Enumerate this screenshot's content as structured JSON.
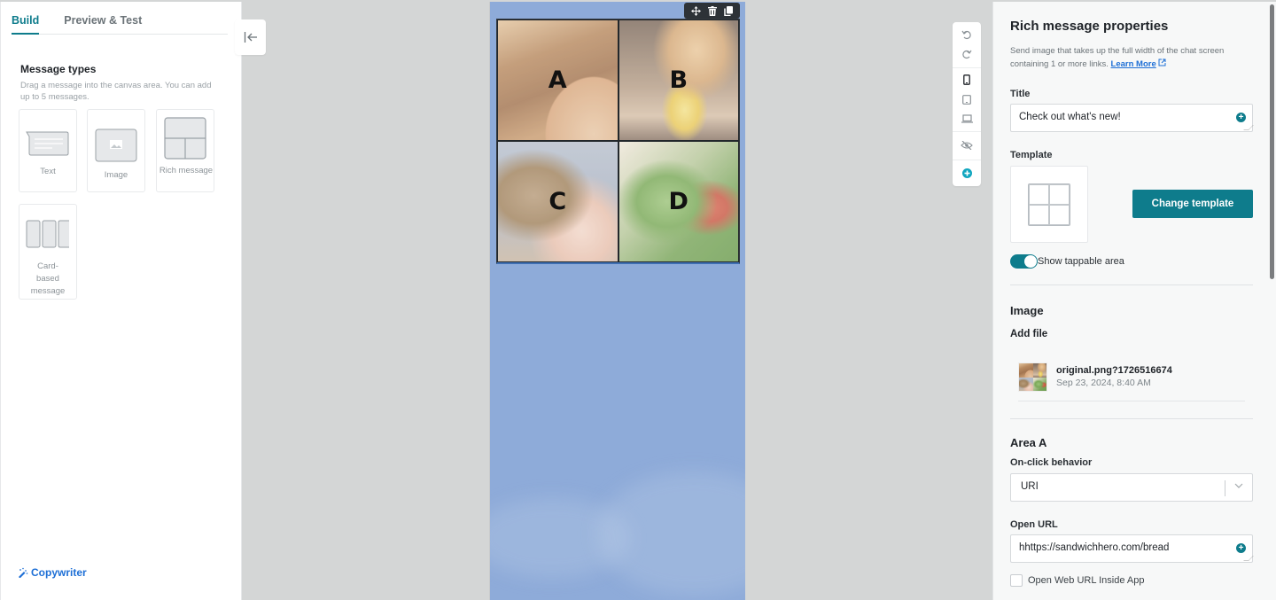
{
  "left_panel": {
    "tabs": [
      {
        "label": "Build",
        "active": true
      },
      {
        "label": "Preview & Test",
        "active": false
      }
    ],
    "message_types": {
      "title": "Message types",
      "description": "Drag a message into the canvas area. You can add up to 5 messages.",
      "items": [
        {
          "label": "Text",
          "icon": "text-message-icon"
        },
        {
          "label": "Image",
          "icon": "image-message-icon"
        },
        {
          "label": "Rich message",
          "icon": "rich-message-icon"
        },
        {
          "label": "Card-based message",
          "icon": "card-message-icon"
        }
      ]
    },
    "copywriter_label": "Copywriter"
  },
  "canvas": {
    "background_color": "#8eabd9",
    "areas": [
      {
        "letter": "A"
      },
      {
        "letter": "B"
      },
      {
        "letter": "C"
      },
      {
        "letter": "D"
      }
    ],
    "toolbar_icons": [
      "move-icon",
      "trash-icon",
      "duplicate-icon"
    ]
  },
  "vertical_tools": [
    "undo-icon",
    "redo-icon",
    "mobile-view-icon",
    "tablet-view-icon",
    "desktop-view-icon",
    "hide-icon",
    "add-icon"
  ],
  "properties": {
    "title": "Rich message properties",
    "description": "Send image that takes up the full width of the chat screen containing 1 or more links.",
    "learn_more": "Learn More",
    "title_label": "Title",
    "title_value": "Check out what's new!",
    "template_label": "Template",
    "change_template": "Change template",
    "show_tappable_label": "Show tappable area",
    "show_tappable_on": true,
    "image_section": "Image",
    "add_file_label": "Add file",
    "file": {
      "name": "original.png?1726516674",
      "date": "Sep 23, 2024, 8:40 AM"
    },
    "area_title": "Area A",
    "onclick_label": "On-click behavior",
    "onclick_value": "URI",
    "open_url_label": "Open URL",
    "open_url_value": "hhttps://sandwichhero.com/bread",
    "open_inside_app_label": "Open Web URL Inside App",
    "open_inside_app_checked": false
  },
  "colors": {
    "accent": "#0e7c8c",
    "link": "#1d6fd6"
  }
}
